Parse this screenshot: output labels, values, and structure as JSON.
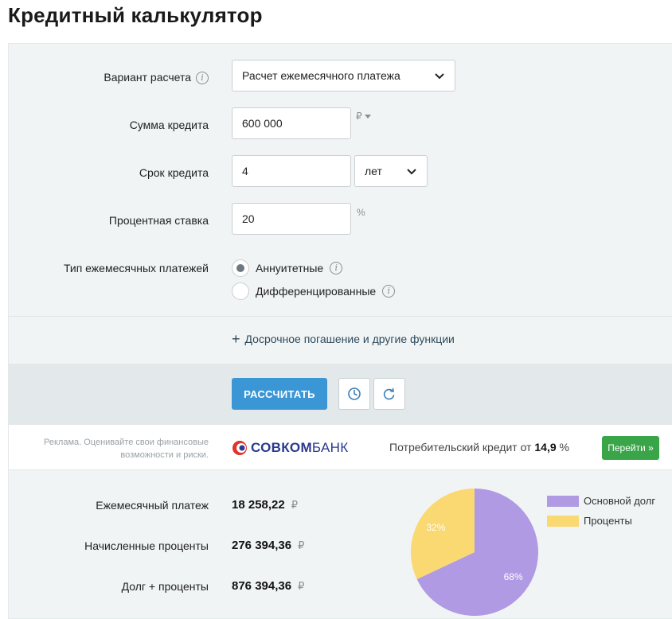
{
  "page": {
    "title": "Кредитный калькулятор"
  },
  "form": {
    "calc_variant": {
      "label": "Вариант расчета",
      "value": "Расчет ежемесячного платежа"
    },
    "loan_amount": {
      "label": "Сумма кредита",
      "value": "600 000",
      "unit": "₽"
    },
    "loan_term": {
      "label": "Срок кредита",
      "value": "4",
      "unit_value": "лет"
    },
    "interest_rate": {
      "label": "Процентная ставка",
      "value": "20",
      "unit": "%"
    },
    "payment_type": {
      "label": "Тип ежемесячных платежей",
      "options": [
        {
          "label": "Аннуитетные",
          "selected": true
        },
        {
          "label": "Дифференцированные",
          "selected": false
        }
      ]
    },
    "extra_link": "Досрочное погашение и другие функции"
  },
  "actions": {
    "calculate_label": "РАССЧИТАТЬ",
    "history_icon": "clock-icon",
    "reset_icon": "refresh-icon"
  },
  "ad": {
    "note_line1": "Реклама. Оценивайте свои финансовые",
    "note_line2": "возможности и риски.",
    "brand_part1": "СОВКОМ",
    "brand_part2": "БАНК",
    "offer_prefix": "Потребительский кредит от",
    "offer_rate": "14,9",
    "offer_unit": "%",
    "button_label": "Перейти »"
  },
  "results": {
    "monthly_payment": {
      "label": "Ежемесячный платеж",
      "value": "18 258,22",
      "unit": "₽"
    },
    "accrued_interest": {
      "label": "Начисленные проценты",
      "value": "276 394,36",
      "unit": "₽"
    },
    "total": {
      "label": "Долг + проценты",
      "value": "876 394,36",
      "unit": "₽"
    }
  },
  "chart_data": {
    "type": "pie",
    "legend_position": "right",
    "slices": [
      {
        "name": "Основной долг",
        "percent": 68,
        "label": "68%",
        "color": "#b09ae3"
      },
      {
        "name": "Проценты",
        "percent": 32,
        "label": "32%",
        "color": "#fad872"
      }
    ]
  },
  "colors": {
    "primary_button": "#3b96d6",
    "go_button": "#3aa548",
    "panel_bg": "#f1f4f4"
  }
}
